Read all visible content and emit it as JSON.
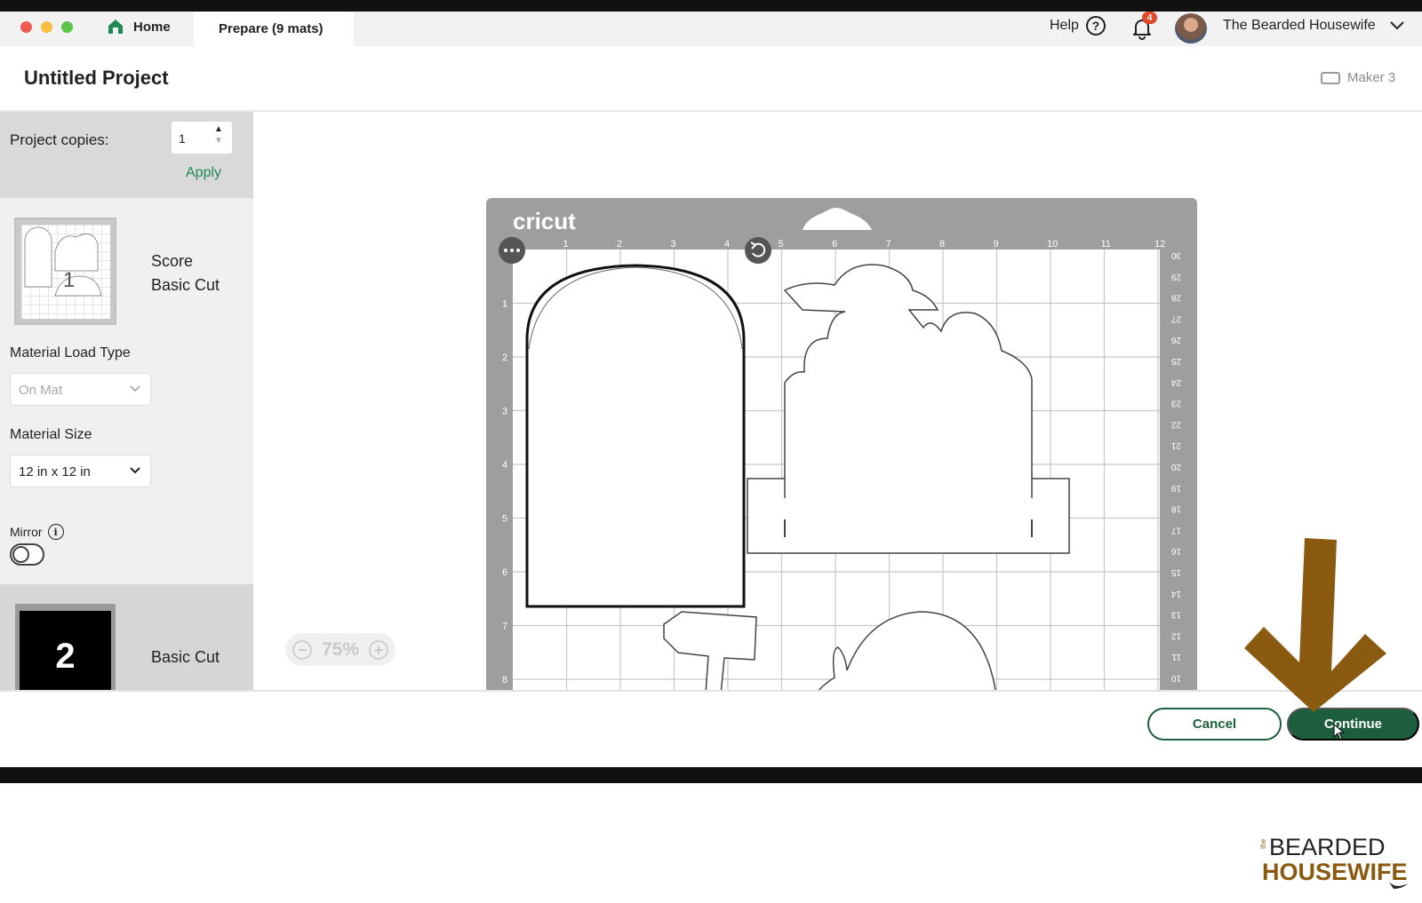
{
  "titlebar": {
    "home_tab": "Home",
    "prepare_tab": "Prepare (9 mats)",
    "help_label": "Help",
    "help_icon_glyph": "?",
    "notification_count": "4",
    "user_name": "The Bearded Housewife"
  },
  "header": {
    "project_title": "Untitled Project",
    "machine": "Maker 3"
  },
  "sidebar": {
    "copies_label": "Project copies:",
    "copies_value": "1",
    "apply_label": "Apply",
    "mat1": {
      "line1": "Score",
      "line2": "Basic Cut",
      "number": "1"
    },
    "material_load_type_label": "Material Load Type",
    "material_load_type_value": "On Mat",
    "material_size_label": "Material Size",
    "material_size_value": "12 in x 12 in",
    "mirror_label": "Mirror",
    "mirror_on": false,
    "mat2": {
      "label": "Basic Cut",
      "number": "2"
    }
  },
  "canvas": {
    "brand": "cricut",
    "ruler_top": [
      "1",
      "2",
      "3",
      "4",
      "5",
      "6",
      "7",
      "8",
      "9",
      "10",
      "11",
      "12"
    ],
    "ruler_left": [
      "1",
      "2",
      "3",
      "4",
      "5",
      "6",
      "7",
      "8"
    ],
    "ruler_right": [
      "30",
      "29",
      "28",
      "27",
      "26",
      "25",
      "24",
      "23",
      "22",
      "21",
      "20",
      "19",
      "18",
      "17",
      "16",
      "15",
      "14",
      "13",
      "12",
      "11",
      "10"
    ],
    "zoom_label": "75%"
  },
  "footer": {
    "cancel_label": "Cancel",
    "continue_label": "Continue"
  },
  "watermark": {
    "small": "the",
    "line1": "BEARDED",
    "line2": "HOUSEWIFE"
  },
  "colors": {
    "primary_green": "#1c5e3d",
    "apply_green": "#1f8a55",
    "arrow_brown": "#8a5a10",
    "mat_grey": "#9e9e9e"
  }
}
